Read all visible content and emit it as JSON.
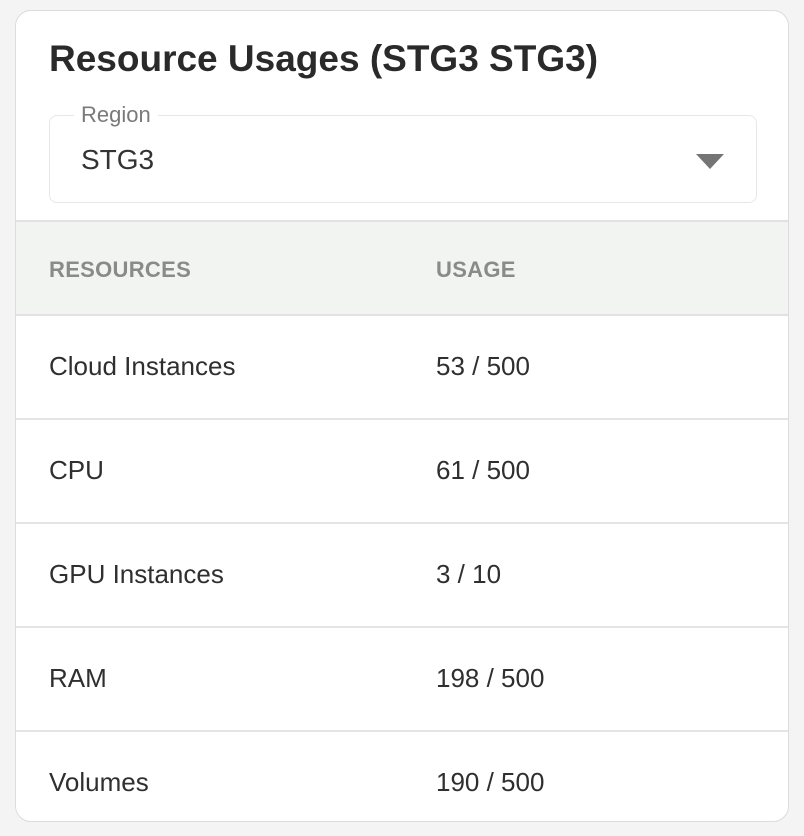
{
  "card": {
    "title": "Resource Usages (STG3 STG3)"
  },
  "region_select": {
    "label": "Region",
    "value": "STG3",
    "icon": "caret-down-icon"
  },
  "table": {
    "headers": [
      "RESOURCES",
      "USAGE"
    ],
    "rows": [
      {
        "resource": "Cloud Instances",
        "usage": "53 / 500"
      },
      {
        "resource": "CPU",
        "usage": "61 / 500"
      },
      {
        "resource": "GPU Instances",
        "usage": "3 / 10"
      },
      {
        "resource": "RAM",
        "usage": "198 / 500"
      },
      {
        "resource": "Volumes",
        "usage": "190 / 500"
      }
    ]
  }
}
